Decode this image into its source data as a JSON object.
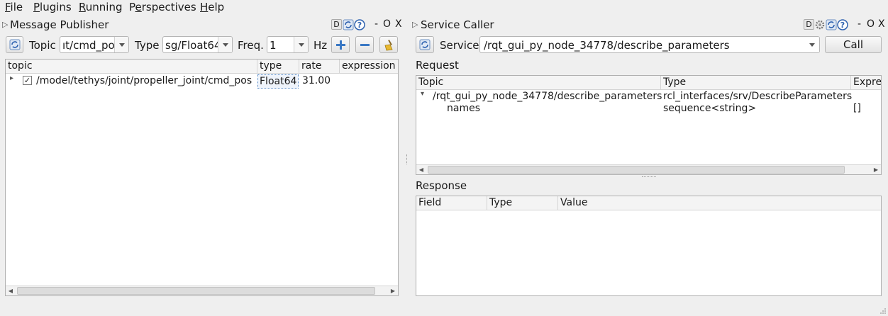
{
  "menubar": {
    "items": [
      {
        "label": "File",
        "underline": "F",
        "rest": "ile"
      },
      {
        "label": "Plugins",
        "underline": "P",
        "rest": "lugins"
      },
      {
        "label": "Running",
        "underline": "R",
        "rest": "unning"
      },
      {
        "label": "Perspectives",
        "underline": "e",
        "pre": "P",
        "rest": "rspectives"
      },
      {
        "label": "Help",
        "underline": "H",
        "rest": "elp"
      }
    ]
  },
  "publisher": {
    "title": "Message Publisher",
    "title_controls": {
      "d": "D",
      "minimize": "-",
      "float": "O",
      "close": "X"
    },
    "topic_label": "Topic",
    "topic_value": "ıt/cmd_pos",
    "type_label": "Type",
    "type_value": "sg/Float64",
    "freq_label": "Freq.",
    "freq_value": "1",
    "hz_label": "Hz",
    "table": {
      "columns": [
        "topic",
        "type",
        "rate",
        "expression"
      ],
      "rows": [
        {
          "topic": "/model/tethys/joint/propeller_joint/cmd_pos",
          "type": "Float64",
          "rate": "31.00",
          "expression": "",
          "checked": true
        }
      ]
    }
  },
  "caller": {
    "title": "Service Caller",
    "title_controls": {
      "d": "D",
      "minimize": "-",
      "float": "O",
      "close": "X"
    },
    "service_label": "Service",
    "service_value": "/rqt_gui_py_node_34778/describe_parameters",
    "call_label": "Call",
    "request_label": "Request",
    "request_table": {
      "columns": [
        "Topic",
        "Type",
        "Expre"
      ],
      "rows": [
        {
          "topic": "/rqt_gui_py_node_34778/describe_parameters",
          "type": "rcl_interfaces/srv/DescribeParameters",
          "expression": ""
        },
        {
          "topic": "names",
          "type": "sequence<string>",
          "expression": "[]"
        }
      ]
    },
    "response_label": "Response",
    "response_table": {
      "columns": [
        "Field",
        "Type",
        "Value"
      ]
    }
  },
  "colors": {
    "background": "#efefef",
    "panel": "#ffffff",
    "accent_blue": "#3a78c4"
  }
}
